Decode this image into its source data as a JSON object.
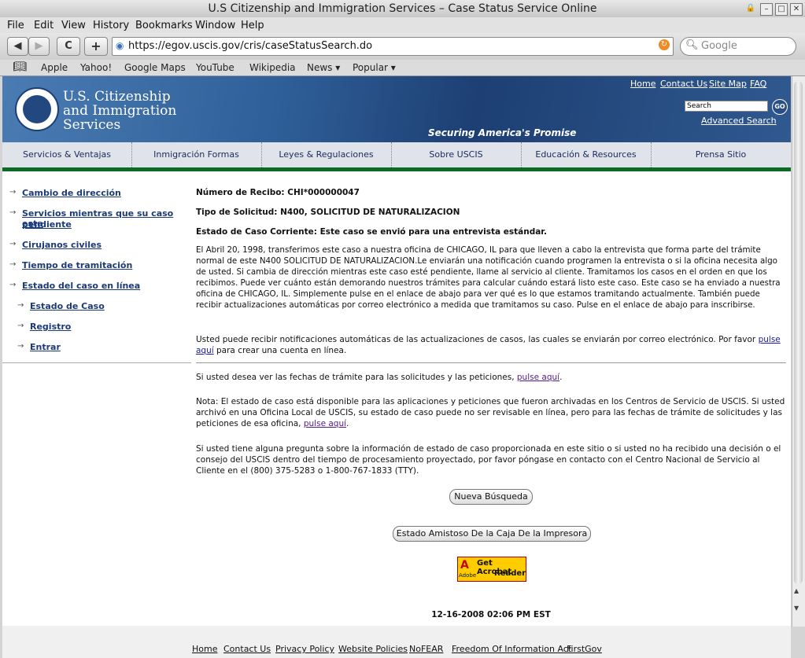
{
  "window": {
    "title": "U.S Citizenship and Immigration Services – Case Status Service Online"
  },
  "menu": [
    "File",
    "Edit",
    "View",
    "History",
    "Bookmarks",
    "Window",
    "Help"
  ],
  "toolbar": {
    "back": "◀",
    "forward": "▶",
    "reload": "C",
    "add": "+",
    "url": "https://egov.uscis.gov/cris/caseStatusSearch.do",
    "search_placeholder": "Google"
  },
  "bookmarks": [
    "Apple",
    "Yahoo!",
    "Google Maps",
    "YouTube",
    "Wikipedia",
    "News ▾",
    "Popular ▾"
  ],
  "banner": {
    "logo_lines": [
      "U.S. Citizenship",
      "and Immigration",
      "Services"
    ],
    "top_links": [
      "Home",
      "Contact Us",
      "Site Map",
      "FAQ"
    ],
    "search_value": "Search",
    "go": "GO",
    "advanced": "Advanced Search",
    "tagline": "Securing America's Promise"
  },
  "nav": [
    "Servicios & Ventajas",
    "Inmigración Formas",
    "Leyes & Regulaciones",
    "Sobre USCIS",
    "Educación & Resources",
    "Prensa Sitio"
  ],
  "sidebar": {
    "items": [
      "Cambio de dirección",
      "Servicios mientras que su caso esta",
      "pendiente",
      "Cirujanos civiles",
      "Tiempo de tramitación",
      "Estado del caso en línea"
    ],
    "sub": [
      "Estado de Caso",
      "Registro",
      "Entrar"
    ]
  },
  "main": {
    "receipt_label": "Número de Recibo: CHI*000000047",
    "type_label": "Tipo de Solicitud: N400, SOLICITUD DE NATURALIZACION",
    "status_label": "Estado de Caso Corriente: Este caso se envió para una entrevista estándar.",
    "para1": "El Abril 20, 1998, transferimos este caso a nuestra oficina de CHICAGO, IL para que lleven a cabo la entrevista que forma parte del trámite normal de este N400 SOLICITUD DE NATURALIZACION.Le enviarán una notificación cuando programen la entrevista o si la oficina necesita algo de usted. Si cambia de dirección mientras este caso esté pendiente, llame al servicio al cliente. Tramitamos los casos en el orden en que los recibimos. Puede ver cuánto están demorando nuestros trámites para calcular cuándo estará listo este caso. Este caso se ha enviado a nuestra oficina de CHICAGO, IL. Simplemente pulse en el enlace de abajo para ver qué es lo que estamos tramitando actualmente. También puede recibir actualizaciones automáticas por correo electrónico a medida que tramitamos su caso. Pulse en el enlace de abajo para inscribirse.",
    "para2a": "Usted puede recibir notificaciones automáticas de las actualizaciones de casos, las cuales se enviarán por correo electrónico. Por favor ",
    "para2link": "pulse aquí",
    "para2b": " para crear una cuenta en línea.",
    "para3a": "Si usted desea ver las fechas de trámite para las solicitudes y las peticiones, ",
    "para3link": "pulse aquí",
    "para3b": ".",
    "para4a": "Nota: El estado de caso está disponible para las aplicaciones y peticiones que fueron archivadas en los Centros de Servicio de USCIS. Si usted archivó en una Oficina Local de USCIS, su estado de caso puede no ser revisable en línea, pero para las fechas de trámite de solicitudes y las peticiones de esa oficina, ",
    "para4link": "pulse aquí",
    "para4b": ".",
    "para5": "Si usted tiene alguna pregunta sobre la información de estado de caso proporcionada en este sitio o si usted no ha recibido una decisión o el consejo del USCIS dentro del tiempo de procesamiento proyectado, por favor póngase en contacto con el Centro Nacional de Servicio al Cliente en el (800) 375-5283 o 1-800-767-1833 (TTY).",
    "new_search": "Nueva Búsqueda",
    "print_btn": "Estado Amistoso De la Caja De la Impresora",
    "acrobat_line1": "Get Acrobat",
    "acrobat_line2": "Reader",
    "acrobat_brand": "Adobe",
    "timestamp": "12-16-2008 02:06 PM EST"
  },
  "footer": [
    "Home",
    "Contact Us",
    "Privacy Policy",
    "Website Policies",
    "NoFEAR",
    "Freedom Of Information Act",
    "FirstGov"
  ]
}
